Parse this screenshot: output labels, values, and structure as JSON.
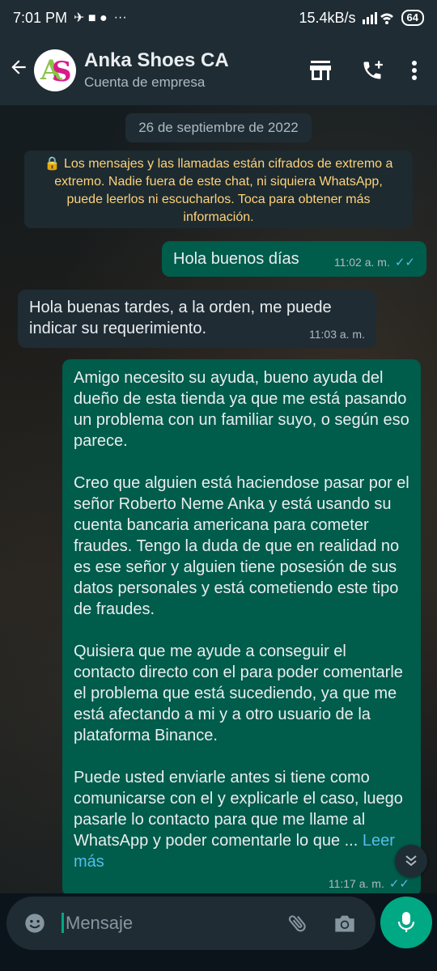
{
  "status_bar": {
    "time": "7:01 PM",
    "indicators": "✈ ■ ●",
    "dots": "···",
    "speed": "15.4kB/s",
    "battery": "64"
  },
  "header": {
    "contact_name": "Anka Shoes CA",
    "subtitle": "Cuenta de empresa"
  },
  "chat": {
    "date": "26 de septiembre de 2022",
    "encryption_notice": "🔒 Los mensajes y las llamadas están cifrados de extremo a extremo. Nadie fuera de este chat, ni siquiera WhatsApp, puede leerlos ni escucharlos. Toca para obtener más información.",
    "messages": [
      {
        "text": "Hola buenos días",
        "time": "11:02 a. m.",
        "ticks": "✓✓"
      },
      {
        "text": "Hola buenas tardes, a la orden, me puede indicar su requerimiento.",
        "time": "11:03 a. m."
      },
      {
        "text": "Amigo necesito su ayuda, bueno ayuda del dueño de esta tienda ya que me está pasando un problema con un familiar suyo, o según eso parece.\n\nCreo que alguien está haciendose pasar por el señor Roberto Neme Anka y está usando su cuenta bancaria americana para cometer fraudes. Tengo la duda de que en realidad no es ese señor y alguien tiene posesión de sus datos personales y está cometiendo este tipo de fraudes.\n\nQuisiera que me ayude a conseguir el contacto directo con el para poder comentarle el problema que está sucediendo, ya que me está afectando a mi y a otro usuario de la plataforma Binance.\n\nPuede usted enviarle antes si tiene como comunicarse con el y explicarle el caso, luego pasarle lo contacto para que me llame al WhatsApp y poder comentarle lo que ...",
        "read_more": "Leer más",
        "time": "11:17 a. m.",
        "ticks": "✓✓"
      }
    ]
  },
  "input": {
    "placeholder": "Mensaje"
  },
  "icons": {
    "back": "arrow-left-icon",
    "store": "store-icon",
    "add_call": "add-call-icon",
    "menu": "more-vert-icon",
    "emoji": "emoji-icon",
    "attach": "attach-icon",
    "camera": "camera-icon",
    "mic": "mic-icon",
    "scroll": "chevron-down-icon"
  },
  "colors": {
    "outgoing": "#005c4b",
    "incoming": "#1f2c34",
    "accent": "#00a884",
    "tick": "#53bdeb",
    "notice": "#ffd279"
  }
}
